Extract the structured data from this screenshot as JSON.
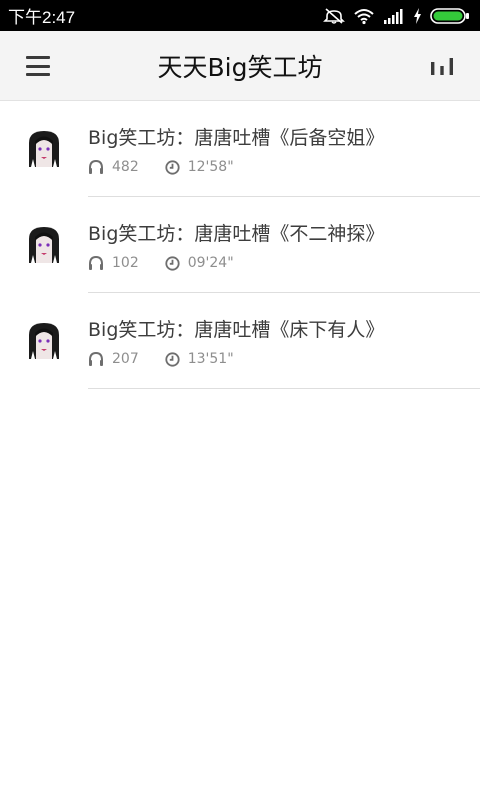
{
  "status_bar": {
    "time": "下午2:47"
  },
  "header": {
    "title": "天天Big笑工坊"
  },
  "episodes": [
    {
      "title": "Big笑工坊：唐唐吐槽《后备空姐》",
      "plays": "482",
      "duration": "12'58\""
    },
    {
      "title": "Big笑工坊：唐唐吐槽《不二神探》",
      "plays": "102",
      "duration": "09'24\""
    },
    {
      "title": "Big笑工坊：唐唐吐槽《床下有人》",
      "plays": "207",
      "duration": "13'51\""
    }
  ],
  "colors": {
    "statusbar_bg": "#000000",
    "appbar_bg": "#f4f4f4",
    "battery_green": "#34c93a",
    "text_primary": "#3d3d3d",
    "text_meta": "#8e8e8e"
  },
  "icons": {
    "menu": "hamburger-icon",
    "stats": "bar-chart-icon",
    "plays": "headphones-icon",
    "duration": "clock-icon",
    "thumb": "podcast-thumbnail-icon"
  }
}
